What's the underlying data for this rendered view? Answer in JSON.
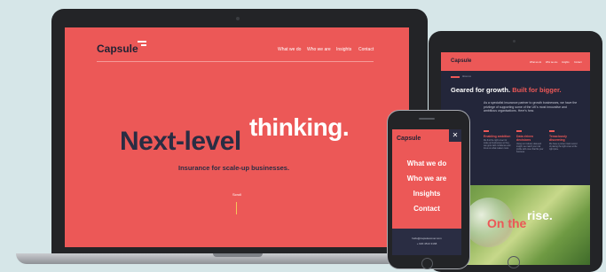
{
  "laptop": {
    "logo": "Capsule",
    "nav": [
      "What we do",
      "Who we are",
      "Insights",
      "Contact"
    ],
    "headline_dark": "Next-level",
    "headline_light": "thinking.",
    "subheadline": "Insurance for scale-up businesses.",
    "scroll_label": "Scroll"
  },
  "tablet": {
    "logo": "Capsule",
    "nav": [
      "What we do",
      "Who we are",
      "Insights",
      "Contact"
    ],
    "marker_text": "About us",
    "headline": "Geared for growth.",
    "headline_accent": "Built for bigger.",
    "paragraph": "As a specialist insurance partner to growth businesses, we have the privilege of supporting some of the UK's most innovative and ambitious organisations. Here's how.",
    "columns": [
      {
        "title": "Enabling ambition",
        "text": "We find the right cover for scale-up businesses so they can grow with confidence and focus on what matters most."
      },
      {
        "title": "Data driven decisions",
        "text": "Using our industry data and insight, we match your risk profile with cover that fits your business."
      },
      {
        "title": "Tenaciously discerning",
        "text": "We have a proven track record of placing the right cover at the right price."
      }
    ],
    "hero_word_accent": "On the",
    "hero_word_light": "rise."
  },
  "phone": {
    "logo": "Capsule",
    "close_icon": "close-icon",
    "menu": [
      "What we do",
      "Who we are",
      "Insights",
      "Contact"
    ],
    "email": "hello@capsulecover.com",
    "phone": "+ 020 4513 3168"
  }
}
